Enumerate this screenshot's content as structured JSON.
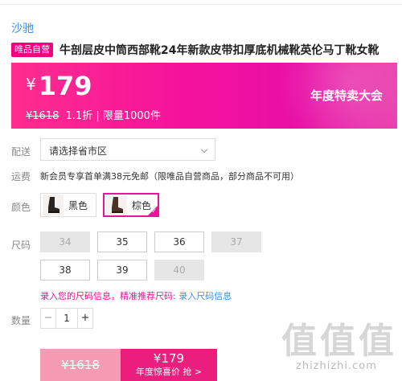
{
  "brand": "沙驰",
  "title": {
    "tag": "唯品自营",
    "text": "牛剖层皮中筒西部靴24年新款皮带扣厚底机械靴英伦马丁靴女靴"
  },
  "price": {
    "currency": "¥",
    "current": "179",
    "original": "¥1618",
    "discount": "1.1折",
    "separator": "|",
    "limit": "限量1000件",
    "event": "年度特卖大会"
  },
  "delivery": {
    "label": "配送",
    "placeholder": "请选择省市区"
  },
  "shipping": {
    "label": "运费",
    "text": "新会员专享首单满38元免邮（限唯品自营商品，部分商品不可用）"
  },
  "color": {
    "label": "颜色",
    "options": [
      {
        "name": "黑色",
        "selected": false,
        "swatch": "#2a2420"
      },
      {
        "name": "棕色",
        "selected": true,
        "swatch": "#4a3324"
      }
    ]
  },
  "size": {
    "label": "尺码",
    "options": [
      {
        "value": "34",
        "available": false
      },
      {
        "value": "35",
        "available": true
      },
      {
        "value": "36",
        "available": true
      },
      {
        "value": "37",
        "available": false
      },
      {
        "value": "38",
        "available": true
      },
      {
        "value": "39",
        "available": true
      },
      {
        "value": "40",
        "available": false
      }
    ],
    "tip": "录入您的尺码信息，精准推荐尺码:",
    "tip_link": "录入尺码信息"
  },
  "quantity": {
    "label": "数量",
    "minus": "−",
    "value": "1",
    "plus": "+"
  },
  "buy": {
    "original": "¥1618",
    "price": "¥179",
    "label": "年度惊喜价 抢 >"
  },
  "watermark": {
    "glyphs": "值值值",
    "url": "zhizhizhi.com"
  },
  "colors": {
    "accent": "#f10180",
    "link": "#3a8ee6",
    "buy_main": "#ea1e7c",
    "buy_orig": "#f79bb4"
  }
}
